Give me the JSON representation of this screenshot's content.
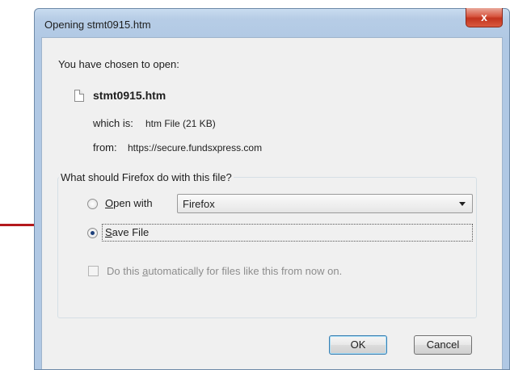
{
  "window": {
    "title": "Opening stmt0915.htm",
    "close_label": "x"
  },
  "info": {
    "intro": "You have chosen to open:",
    "filename": "stmt0915.htm",
    "which_is_label": "which is:",
    "which_is_value": "htm File (21 KB)",
    "from_label": "from:",
    "from_value": "https://secure.fundsxpress.com"
  },
  "action_group": {
    "legend": "What should Firefox do with this file?",
    "open_with": {
      "prefix": "",
      "accel": "O",
      "rest": "pen with",
      "checked": false
    },
    "app_select": {
      "selected": "Firefox"
    },
    "save_file": {
      "accel": "S",
      "rest": "ave File",
      "checked": true
    },
    "auto_checkbox": {
      "before": "Do this ",
      "accel": "a",
      "after": "utomatically for files like this from now on.",
      "checked": false,
      "enabled": false
    }
  },
  "buttons": {
    "ok": "OK",
    "cancel": "Cancel"
  },
  "colors": {
    "annotation_arrow": "#b4191d",
    "title_bar": "#b7cde6",
    "dialog_bg": "#f0f0f0",
    "close_button": "#c2341e"
  }
}
